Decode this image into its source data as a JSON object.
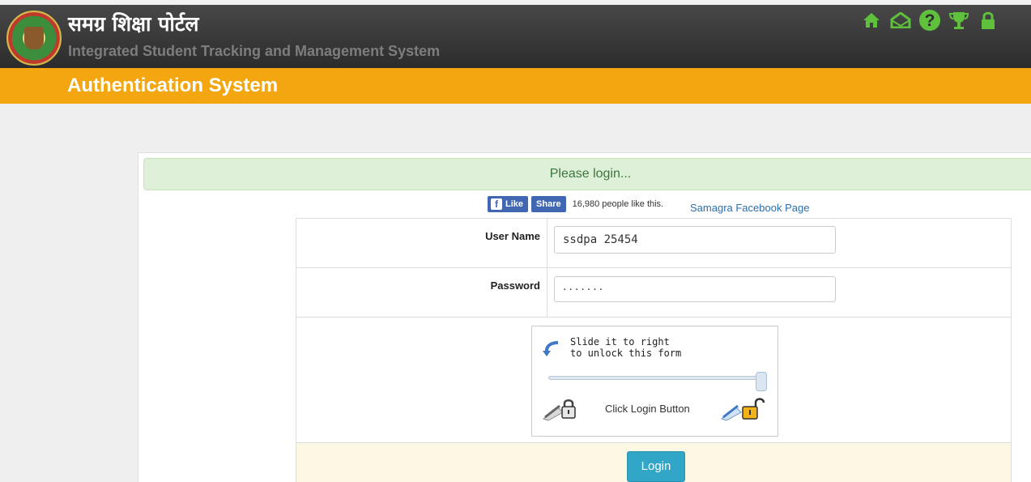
{
  "header": {
    "title_hindi": "समग्र शिक्षा पोर्टल",
    "subtitle": "Integrated Student Tracking and Management System",
    "icons": [
      "home-icon",
      "mail-icon",
      "help-icon",
      "trophy-icon",
      "lock-icon"
    ],
    "help_glyph": "?"
  },
  "banner": {
    "title": "Authentication System"
  },
  "alert": {
    "text": "Please login..."
  },
  "facebook": {
    "like_label": "Like",
    "share_label": "Share",
    "count_text": "16,980 people like this.",
    "page_link": "Samagra Facebook Page"
  },
  "form": {
    "username_label": "User Name",
    "username_value": "ssdpa 25454",
    "password_label": "Password",
    "password_mask": ".......",
    "slider_line1": "Slide it to right",
    "slider_line2": "to unlock this form",
    "click_text": "Click Login Button",
    "login_label": "Login"
  },
  "colors": {
    "header_bg": "#333333",
    "banner_bg": "#f3a60f",
    "icon_green": "#5fc13b",
    "login_button": "#31a6c6"
  }
}
